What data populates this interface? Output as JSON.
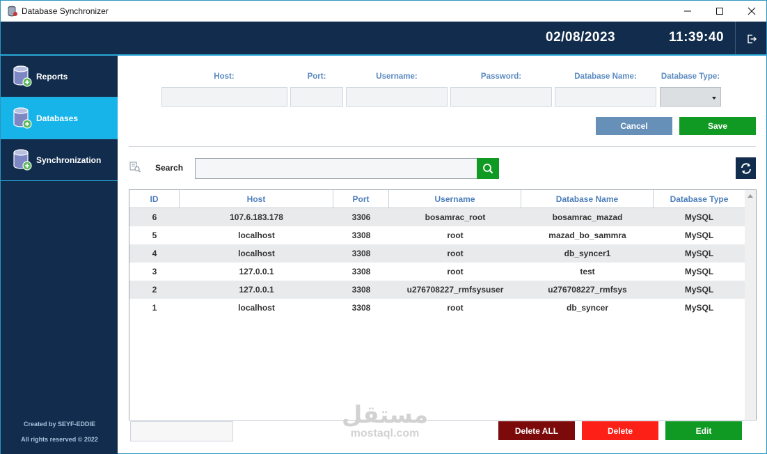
{
  "window": {
    "title": "Database Synchronizer"
  },
  "header": {
    "date": "02/08/2023",
    "time": "11:39:40"
  },
  "sidebar": {
    "items": [
      {
        "label": "Reports"
      },
      {
        "label": "Databases"
      },
      {
        "label": "Synchronization"
      }
    ],
    "active_index": 1,
    "credit_line1": "Created by SEYF-EDDIE",
    "credit_line2": "All rights reserved © 2022"
  },
  "form": {
    "host_label": "Host:",
    "port_label": "Port:",
    "username_label": "Username:",
    "password_label": "Password:",
    "dbname_label": "Database Name:",
    "dbtype_label": "Database Type:",
    "host_value": "",
    "port_value": "",
    "username_value": "",
    "password_value": "",
    "dbname_value": "",
    "dbtype_value": "",
    "cancel_label": "Cancel",
    "save_label": "Save"
  },
  "search": {
    "label": "Search",
    "value": ""
  },
  "table": {
    "columns": [
      "ID",
      "Host",
      "Port",
      "Username",
      "Database Name",
      "Database Type"
    ],
    "rows": [
      [
        "6",
        "107.6.183.178",
        "3306",
        "bosamrac_root",
        "bosamrac_mazad",
        "MySQL"
      ],
      [
        "5",
        "localhost",
        "3308",
        "root",
        "mazad_bo_sammra",
        "MySQL"
      ],
      [
        "4",
        "localhost",
        "3308",
        "root",
        "db_syncer1",
        "MySQL"
      ],
      [
        "3",
        "127.0.0.1",
        "3308",
        "root",
        "test",
        "MySQL"
      ],
      [
        "2",
        "127.0.0.1",
        "3308",
        "u276708227_rmfsysuser",
        "u276708227_rmfsys",
        "MySQL"
      ],
      [
        "1",
        "localhost",
        "3308",
        "root",
        "db_syncer",
        "MySQL"
      ]
    ]
  },
  "actions": {
    "delete_all_label": "Delete ALL",
    "delete_label": "Delete",
    "edit_label": "Edit"
  },
  "watermark": {
    "arabic": "مستقل",
    "latin": "mostaql.com"
  },
  "colors": {
    "navy": "#112c4c",
    "accent_blue": "#17b4ea",
    "green": "#119a23",
    "cancel_blue": "#6690b8",
    "dark_red": "#7d0a0a",
    "red": "#fc2017",
    "label_blue": "#5b8ac0"
  }
}
